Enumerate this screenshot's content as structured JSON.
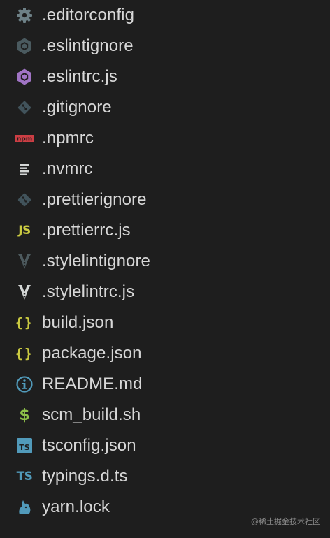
{
  "files": [
    {
      "name": ".editorconfig",
      "icon": "gear-icon",
      "color": "#6d8086"
    },
    {
      "name": ".eslintignore",
      "icon": "eslint-ignore-icon",
      "color": "#4a5a5f"
    },
    {
      "name": ".eslintrc.js",
      "icon": "eslint-icon",
      "color": "#a074c4"
    },
    {
      "name": ".gitignore",
      "icon": "git-icon",
      "color": "#41535b"
    },
    {
      "name": ".npmrc",
      "icon": "npm-icon",
      "color": "#cc3e44"
    },
    {
      "name": ".nvmrc",
      "icon": "text-lines-icon",
      "color": "#d4d7d6"
    },
    {
      "name": ".prettierignore",
      "icon": "git-icon",
      "color": "#41535b"
    },
    {
      "name": ".prettierrc.js",
      "icon": "js-icon",
      "color": "#cbcb41"
    },
    {
      "name": ".stylelintignore",
      "icon": "stylelint-ignore-icon",
      "color": "#4d5a5e"
    },
    {
      "name": ".stylelintrc.js",
      "icon": "stylelint-icon",
      "color": "#d4d7d6"
    },
    {
      "name": "build.json",
      "icon": "json-icon",
      "color": "#cbcb41"
    },
    {
      "name": "package.json",
      "icon": "json-icon",
      "color": "#cbcb41"
    },
    {
      "name": "README.md",
      "icon": "info-icon",
      "color": "#519aba"
    },
    {
      "name": "scm_build.sh",
      "icon": "shell-icon",
      "color": "#8dc149"
    },
    {
      "name": "tsconfig.json",
      "icon": "tsconfig-icon",
      "color": "#519aba"
    },
    {
      "name": "typings.d.ts",
      "icon": "typescript-icon",
      "color": "#519aba"
    },
    {
      "name": "yarn.lock",
      "icon": "yarn-icon",
      "color": "#519aba"
    }
  ],
  "icon_text": {
    "js": "JS",
    "json": "{}",
    "shell": "$",
    "ts": "TS",
    "npm": "npm"
  },
  "watermark": "@稀土掘金技术社区"
}
